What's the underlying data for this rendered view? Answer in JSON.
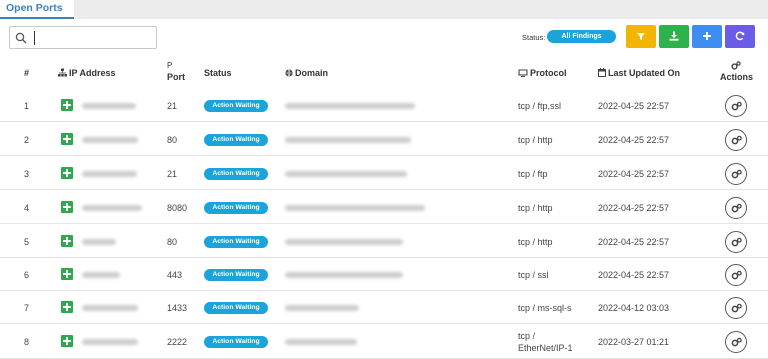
{
  "tab": {
    "label": "Open Ports"
  },
  "toolbar": {
    "status_label": "Status:",
    "status_filter": "All Findings",
    "colors": {
      "filter": "#f3b600",
      "download": "#2fb24c",
      "add": "#3d8ef0",
      "refresh": "#6a5ce6"
    }
  },
  "table": {
    "headers": {
      "num": "#",
      "ip": "IP Address",
      "port_icon": "P",
      "port": "Port",
      "status": "Status",
      "domain": "Domain",
      "protocol": "Protocol",
      "updated": "Last Updated On",
      "actions": "Actions"
    },
    "rows": [
      {
        "num": "1",
        "port": "21",
        "status": "Action Waiting",
        "protocol": "tcp / ftp,ssl",
        "updated": "2022-04-25 22:57"
      },
      {
        "num": "2",
        "port": "80",
        "status": "Action Waiting",
        "protocol": "tcp / http",
        "updated": "2022-04-25 22:57"
      },
      {
        "num": "3",
        "port": "21",
        "status": "Action Waiting",
        "protocol": "tcp / ftp",
        "updated": "2022-04-25 22:57"
      },
      {
        "num": "4",
        "port": "8080",
        "status": "Action Waiting",
        "protocol": "tcp / http",
        "updated": "2022-04-25 22:57"
      },
      {
        "num": "5",
        "port": "80",
        "status": "Action Waiting",
        "protocol": "tcp / http",
        "updated": "2022-04-25 22:57"
      },
      {
        "num": "6",
        "port": "443",
        "status": "Action Waiting",
        "protocol": "tcp / ssl",
        "updated": "2022-04-25 22:57"
      },
      {
        "num": "7",
        "port": "1433",
        "status": "Action Waiting",
        "protocol": "tcp / ms-sql-s",
        "updated": "2022-04-12 03:03"
      },
      {
        "num": "8",
        "port": "2222",
        "status": "Action Waiting",
        "protocol_line1": "tcp /",
        "protocol_line2": "EtherNet/IP-1",
        "updated": "2022-03-27 01:21"
      }
    ]
  }
}
